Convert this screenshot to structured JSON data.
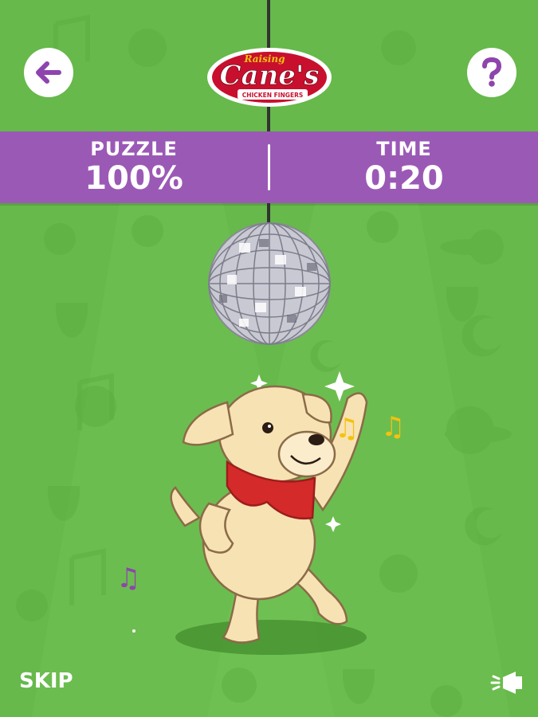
{
  "header": {
    "back_icon": "arrow-left-icon",
    "help_icon": "question-mark-icon",
    "logo": {
      "brand_small": "Raising",
      "brand_main": "Cane's",
      "brand_sub": "CHICKEN FINGERS"
    }
  },
  "stats": {
    "puzzle_label": "PUZZLE",
    "puzzle_value": "100%",
    "time_label": "TIME",
    "time_value": "0:20"
  },
  "footer": {
    "skip_label": "SKIP",
    "megaphone_icon": "megaphone-icon"
  },
  "scene": {
    "notes": [
      "♫",
      "♫",
      "♫"
    ]
  },
  "colors": {
    "background": "#66b94a",
    "banner": "#9b59b6",
    "accent_purple": "#8e44ad",
    "note_yellow": "#f4c20d",
    "scarf_red": "#d42a2a",
    "dog_fur": "#f7e2b4"
  }
}
